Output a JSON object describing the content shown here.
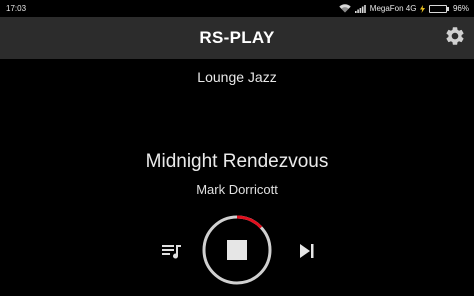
{
  "status_bar": {
    "time": "17:03",
    "carrier": "MegaFon 4G",
    "battery_percent": "96%",
    "battery_level": 0.96,
    "icons": [
      "wifi-icon",
      "signal-icon",
      "charging-icon",
      "battery-icon"
    ]
  },
  "app_bar": {
    "title": "RS-PLAY",
    "settings_icon": "gear-icon"
  },
  "player": {
    "station": "Lounge Jazz",
    "track_title": "Midnight Rendezvous",
    "artist": "Mark Dorricott",
    "progress_fraction": 0.13,
    "controls": {
      "playlist_icon": "playlist-icon",
      "stop_icon": "stop-icon",
      "next_icon": "skip-next-icon"
    }
  },
  "colors": {
    "background": "#000000",
    "app_bar": "#2c2c2c",
    "progress_ring": "#d0d0d0",
    "progress_accent": "#e0101e",
    "battery_fill": "#33c23a"
  }
}
